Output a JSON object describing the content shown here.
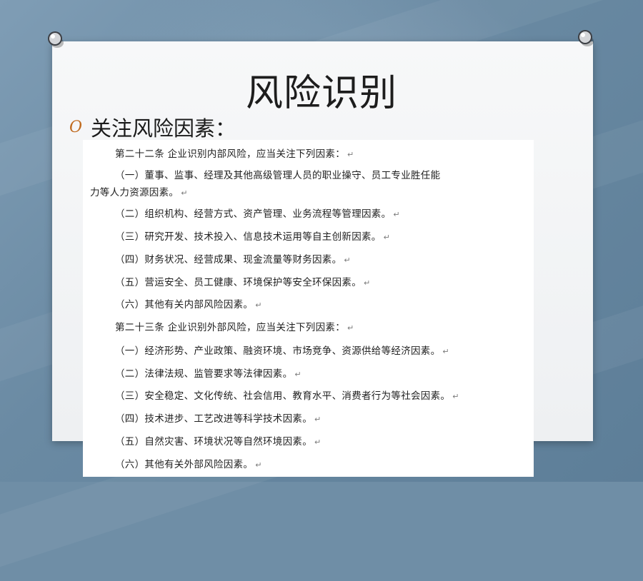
{
  "slide": {
    "title": "风险识别",
    "bullet_text": "关注风险因素：",
    "bullet_marker": "O"
  },
  "document": {
    "paragraph_mark": "↵",
    "lines": [
      "第二十二条 企业识别内部风险，应当关注下列因素：",
      "（一）董事、监事、经理及其他高级管理人员的职业操守、员工专业胜任能",
      "力等人力资源因素。",
      "（二）组织机构、经营方式、资产管理、业务流程等管理因素。",
      "（三）研究开发、技术投入、信息技术运用等自主创新因素。",
      "（四）财务状况、经营成果、现金流量等财务因素。",
      "（五）营运安全、员工健康、环境保护等安全环保因素。",
      "（六）其他有关内部风险因素。",
      "第二十三条 企业识别外部风险，应当关注下列因素：",
      "（一）经济形势、产业政策、融资环境、市场竞争、资源供给等经济因素。",
      "（二）法律法规、监管要求等法律因素。",
      "（三）安全稳定、文化传统、社会信用、教育水平、消费者行为等社会因素。",
      "（四）技术进步、工艺改进等科学技术因素。",
      "（五）自然灾害、环境状况等自然环境因素。",
      "（六）其他有关外部风险因素。"
    ]
  },
  "colors": {
    "background": "#6f8ea6",
    "card": "#f3f4f5",
    "bullet": "#c06a1e",
    "text": "#1d1d1d"
  }
}
